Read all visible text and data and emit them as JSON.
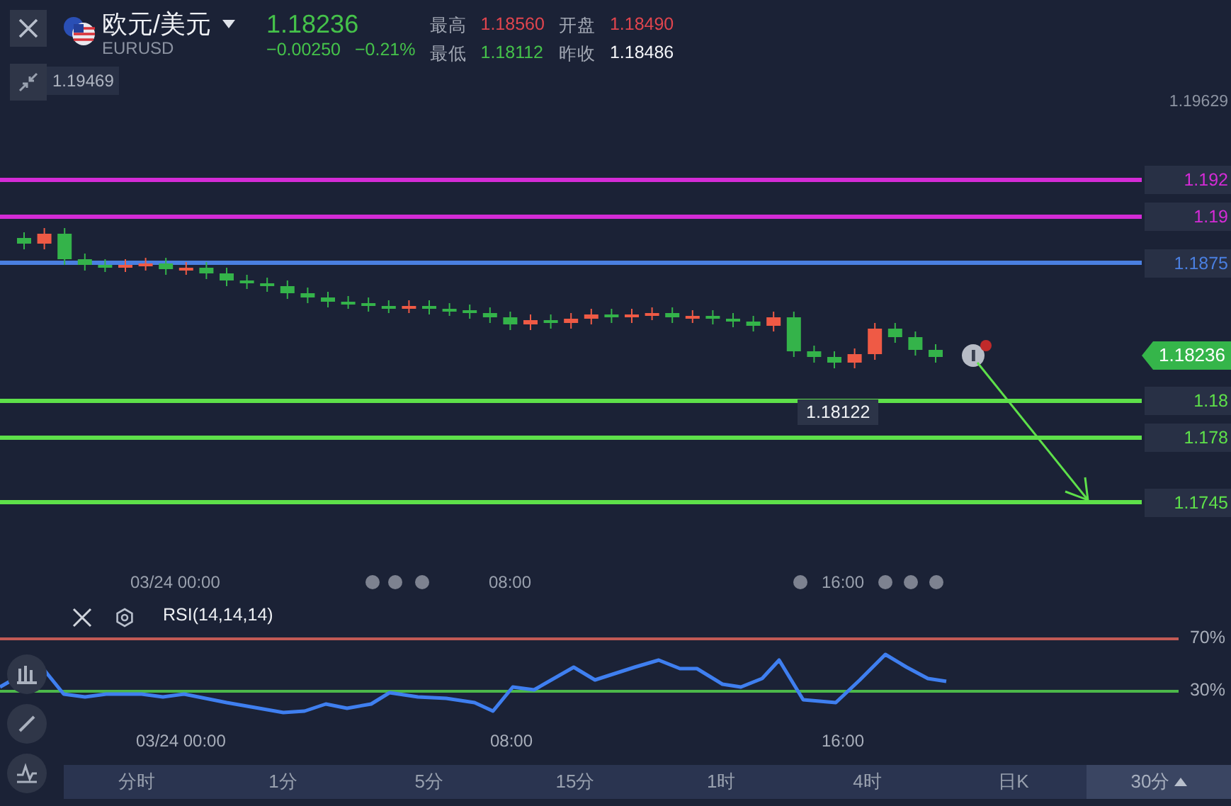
{
  "header": {
    "pair": "欧元/美元",
    "symbol": "EURUSD",
    "price": "1.18236",
    "change": "−0.00250",
    "change_pct": "−0.21%",
    "stats": [
      {
        "label": "最高",
        "value": "1.18560",
        "kind": "up"
      },
      {
        "label": "开盘",
        "value": "1.18490",
        "kind": "up"
      },
      {
        "label": "最低",
        "value": "1.18112",
        "kind": "down"
      },
      {
        "label": "昨收",
        "value": "1.18486",
        "kind": "flat"
      }
    ]
  },
  "chart": {
    "high_label": "1.19469",
    "top_right_label": "1.19629",
    "levels": [
      {
        "label": "1.192",
        "color": "#d42bd6"
      },
      {
        "label": "1.19",
        "color": "#d42bd6"
      },
      {
        "label": "1.1875",
        "color": "#4a7fe0"
      },
      {
        "label": "1.18",
        "color": "#5ee04a"
      },
      {
        "label": "1.178",
        "color": "#5ee04a"
      },
      {
        "label": "1.1745",
        "color": "#5ee04a"
      }
    ],
    "current_price": "1.18236",
    "low_marker": "1.18122",
    "time_labels": [
      "03/24 00:00",
      "08:00",
      "16:00"
    ]
  },
  "rsi": {
    "title": "RSI(14,14,14)",
    "lines": [
      {
        "label": "70%",
        "color": "#c25a55"
      },
      {
        "label": "30%",
        "color": "#4cb84a"
      }
    ],
    "time_labels": [
      "03/24 00:00",
      "08:00",
      "16:00"
    ]
  },
  "timeframes": [
    {
      "label": "分时",
      "selected": false
    },
    {
      "label": "1分",
      "selected": false
    },
    {
      "label": "5分",
      "selected": false
    },
    {
      "label": "15分",
      "selected": false
    },
    {
      "label": "1时",
      "selected": false
    },
    {
      "label": "4时",
      "selected": false
    },
    {
      "label": "日K",
      "selected": false
    },
    {
      "label": "30分",
      "selected": true
    }
  ]
}
